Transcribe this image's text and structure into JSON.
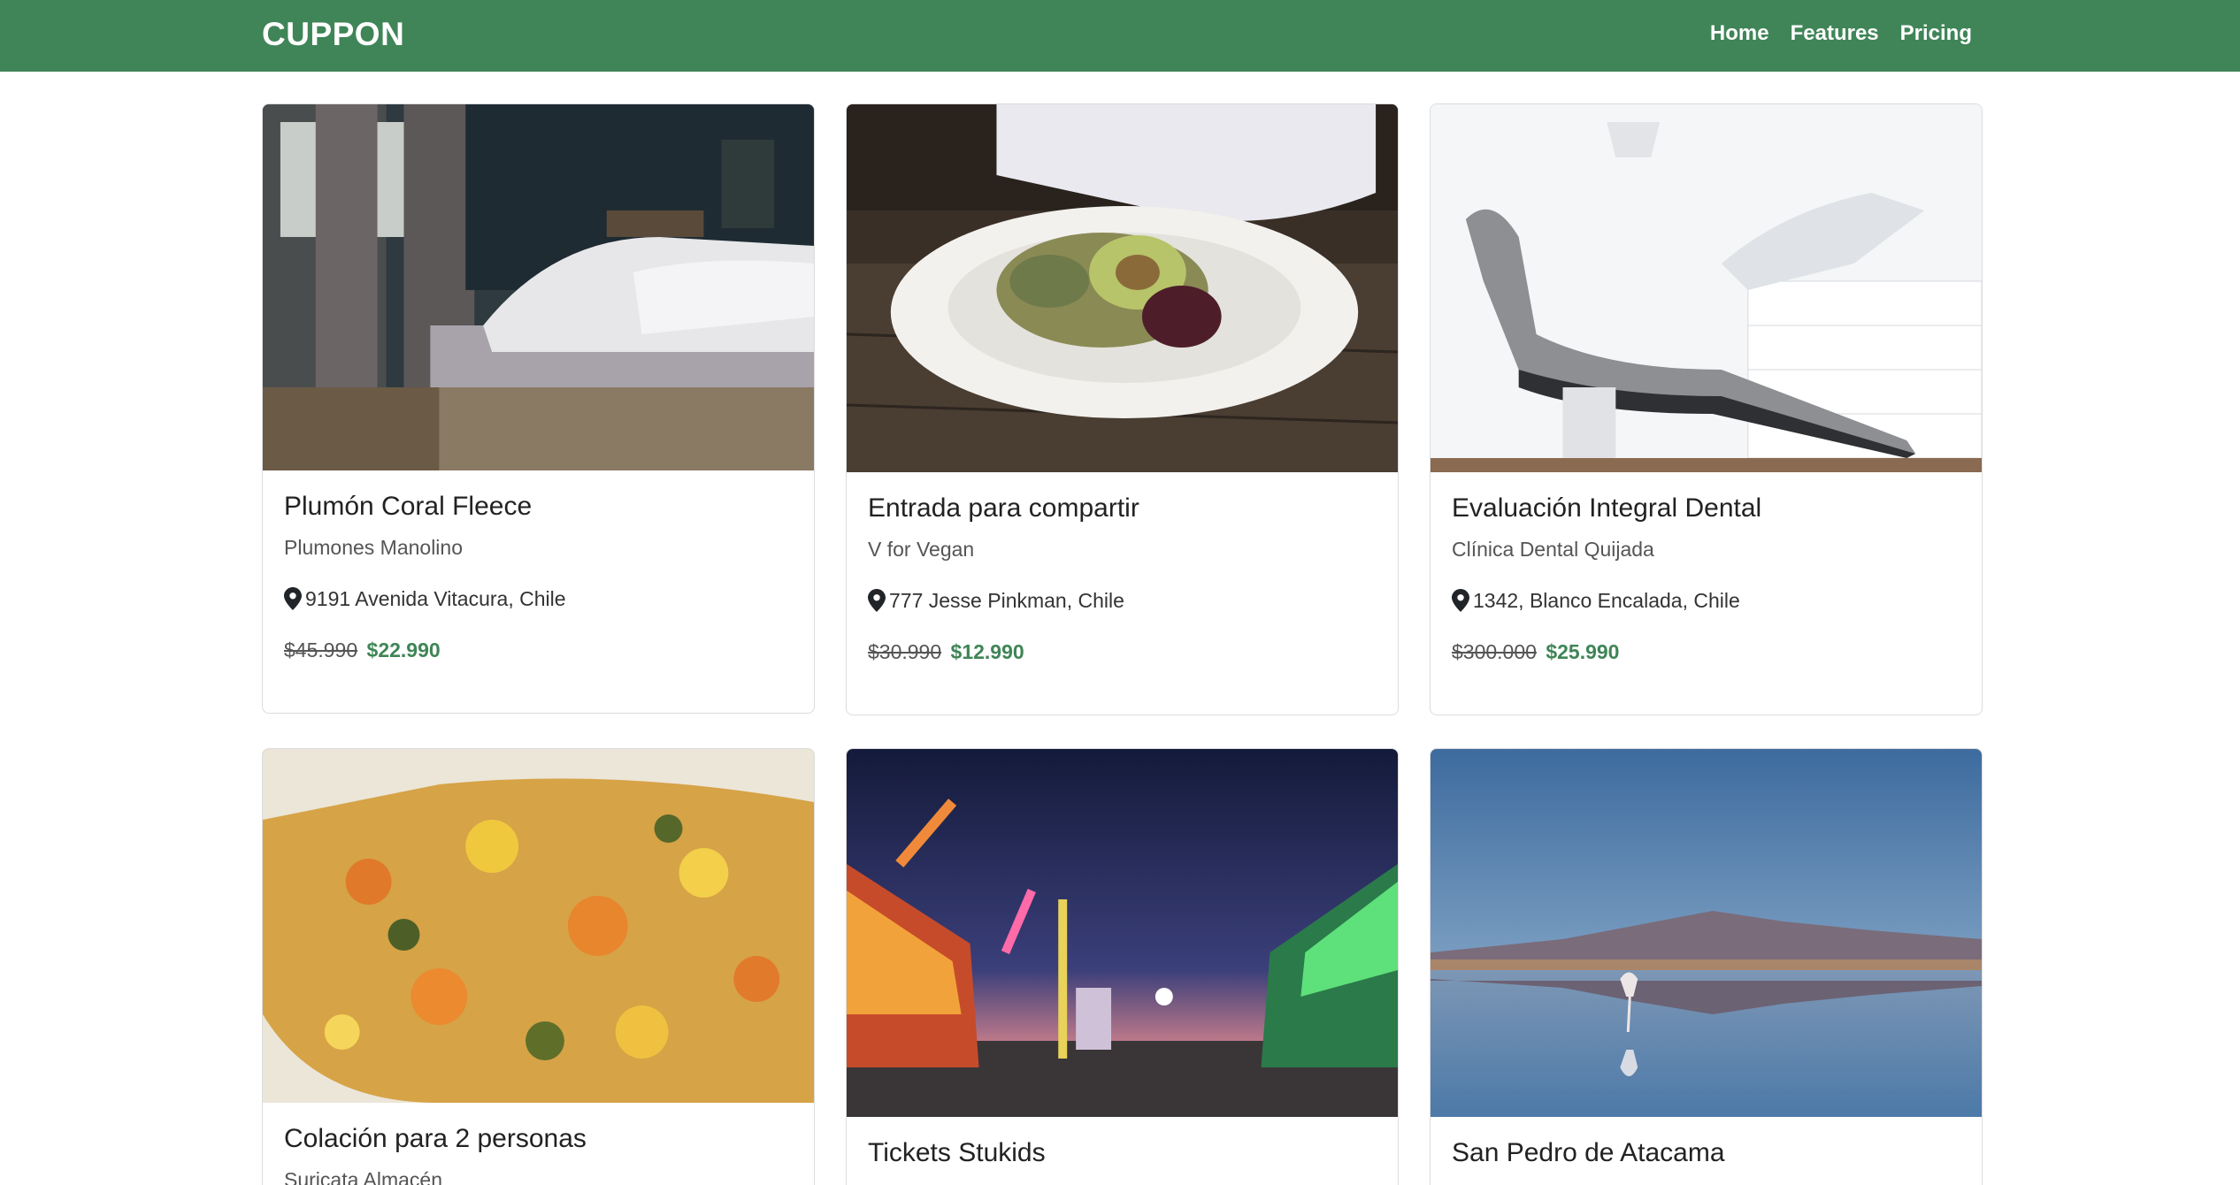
{
  "app": {
    "brand": "CUPPON"
  },
  "nav": {
    "home": "Home",
    "features": "Features",
    "pricing": "Pricing"
  },
  "colors": {
    "brand_green": "#3f8557"
  },
  "cards": [
    {
      "title": "Plumón Coral Fleece",
      "company": "Plumones Manolino",
      "location": "9191 Avenida Vitacura, Chile",
      "price_old": "$45.990",
      "price_new": "$22.990",
      "image": "bedroom-photo"
    },
    {
      "title": "Entrada para compartir",
      "company": "V for Vegan",
      "location": "777 Jesse Pinkman, Chile",
      "price_old": "$30.990",
      "price_new": "$12.990",
      "image": "vegan-plate-photo"
    },
    {
      "title": "Evaluación Integral Dental",
      "company": "Clínica Dental Quijada",
      "location": "1342, Blanco Encalada, Chile",
      "price_old": "$300.000",
      "price_new": "$25.990",
      "image": "dental-chair-photo"
    },
    {
      "title": "Colación para 2 personas",
      "company": "Suricata Almacén",
      "image": "vegetable-dish-photo"
    },
    {
      "title": "Tickets Stukids",
      "image": "amusement-park-photo"
    },
    {
      "title": "San Pedro de Atacama",
      "image": "salt-flat-flamingo-photo"
    }
  ]
}
